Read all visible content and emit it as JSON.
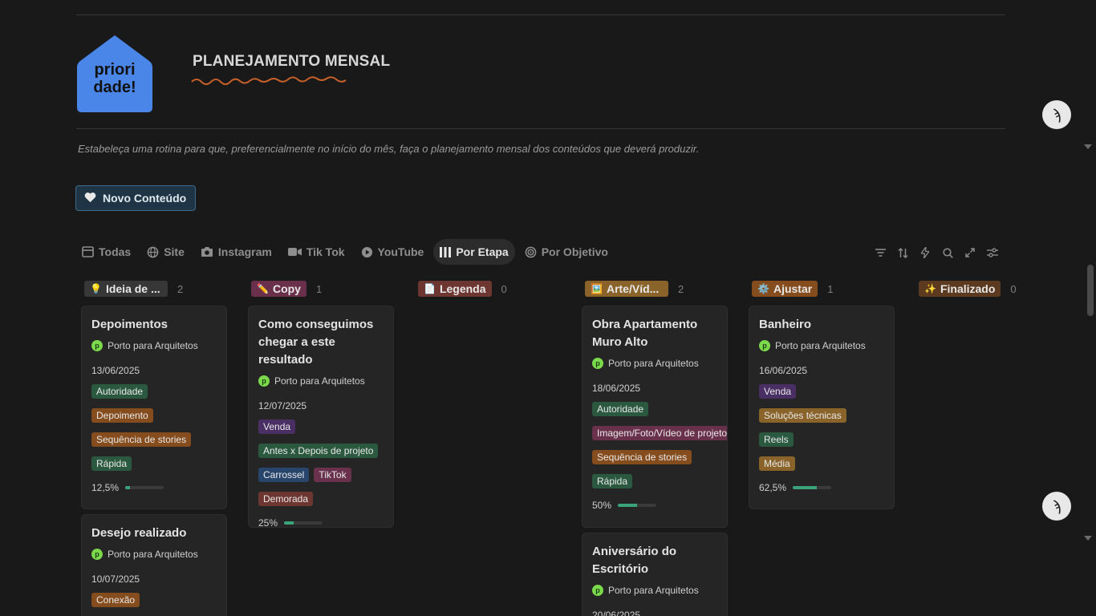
{
  "page": {
    "title": "PLANEJAMENTO MENSAL",
    "logo_text": "priori dade!",
    "description": "Estabeleça uma rotina  para que, preferencialmente no início do mês, faça o planejamento mensal dos conteúdos que deverá produzir.",
    "new_button": "Novo Conteúdo"
  },
  "tabs": [
    {
      "label": "Todas",
      "icon": "table-icon"
    },
    {
      "label": "Site",
      "icon": "globe-icon"
    },
    {
      "label": "Instagram",
      "icon": "camera-icon"
    },
    {
      "label": "Tik Tok",
      "icon": "video-icon"
    },
    {
      "label": "YouTube",
      "icon": "play-icon"
    },
    {
      "label": "Por Etapa",
      "icon": "columns-icon",
      "active": true
    },
    {
      "label": "Por Objetivo",
      "icon": "target-icon"
    }
  ],
  "toolbar": [
    "filter-icon",
    "sort-icon",
    "automation-icon",
    "search-icon",
    "expand-icon",
    "settings-icon"
  ],
  "columns": [
    {
      "label": "Ideia de ...",
      "emoji": "💡",
      "count": "2",
      "color": "#373737"
    },
    {
      "label": "Copy",
      "emoji": "✏️",
      "count": "1",
      "color": "#6a2f4a"
    },
    {
      "label": "Legenda",
      "emoji": "📄",
      "count": "0",
      "color": "#6e3630"
    },
    {
      "label": "Arte/Víd...",
      "emoji": "🖼️",
      "count": "2",
      "color": "#89632a"
    },
    {
      "label": "Ajustar",
      "emoji": "⚙️",
      "count": "1",
      "color": "#854c1d"
    },
    {
      "label": "Finalizado",
      "emoji": "✨",
      "count": "0",
      "color": "#5b3a1f"
    }
  ],
  "cards": {
    "c1": {
      "title": "Depoimentos",
      "owner": "Porto para Arquitetos",
      "date": "13/06/2025",
      "tags": [
        "Autoridade",
        "Depoimento",
        "Sequência de stories",
        "Rápida"
      ],
      "progress": "12,5%"
    },
    "c2": {
      "title": "Desejo realizado",
      "owner": "Porto para Arquitetos",
      "date": "10/07/2025",
      "tags": [
        "Conexão"
      ]
    },
    "c3": {
      "title": "Como conseguimos chegar a este resultado",
      "owner": "Porto para Arquitetos",
      "date": "12/07/2025",
      "tags": [
        "Venda",
        "Antes x Depois de projeto",
        "Carrossel",
        "TikTok",
        "Demorada"
      ],
      "progress": "25%"
    },
    "c4": {
      "title": "Obra Apartamento Muro Alto",
      "owner": "Porto para Arquitetos",
      "date": "18/06/2025",
      "tags": [
        "Autoridade",
        "Imagem/Foto/Vídeo de projeto",
        "Sequência de stories",
        "Rápida"
      ],
      "progress": "50%"
    },
    "c5": {
      "title": "Aniversário do Escritório",
      "owner": "Porto para Arquitetos",
      "date": "20/06/2025"
    },
    "c6": {
      "title": "Banheiro",
      "owner": "Porto para Arquitetos",
      "date": "16/06/2025",
      "tags": [
        "Venda",
        "Soluções técnicas",
        "Reels",
        "Média"
      ],
      "progress": "62,5%"
    }
  },
  "progress_values": {
    "c1": 0.125,
    "c3": 0.25,
    "c4": 0.5,
    "c6": 0.625
  },
  "colors": {
    "accent_green": "#3aa37a",
    "background": "#191919",
    "card": "#252525"
  }
}
